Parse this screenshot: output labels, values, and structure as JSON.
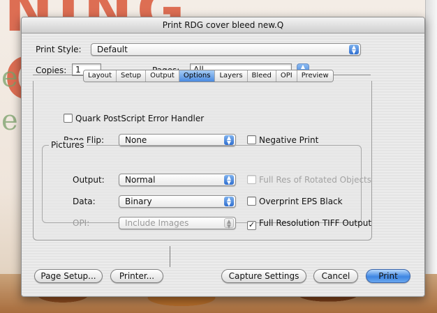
{
  "window": {
    "title": "Print RDG cover bleed new.Q"
  },
  "background": {
    "title_fragment": "NING GUIDE",
    "side_letter_1": "e",
    "side_letter_2": "e"
  },
  "print_style": {
    "label": "Print Style:",
    "value": "Default"
  },
  "copies": {
    "label": "Copies:",
    "value": "1"
  },
  "pages": {
    "label": "Pages:",
    "value": "All"
  },
  "tabs": [
    {
      "label": "Layout"
    },
    {
      "label": "Setup"
    },
    {
      "label": "Output"
    },
    {
      "label": "Options",
      "active": true
    },
    {
      "label": "Layers"
    },
    {
      "label": "Bleed"
    },
    {
      "label": "OPI"
    },
    {
      "label": "Preview"
    }
  ],
  "options": {
    "error_handler": {
      "label": "Quark PostScript Error Handler",
      "checked": false
    },
    "page_flip": {
      "label": "Page Flip:",
      "value": "None"
    },
    "negative_print": {
      "label": "Negative Print",
      "checked": false
    },
    "pictures": {
      "title": "Pictures",
      "output": {
        "label": "Output:",
        "value": "Normal"
      },
      "data": {
        "label": "Data:",
        "value": "Binary"
      },
      "opi": {
        "label": "OPI:",
        "value": "Include Images"
      },
      "full_res_rotated": {
        "label": "Full Res of Rotated Objects",
        "checked": false
      },
      "overprint_eps": {
        "label": "Overprint EPS Black",
        "checked": false
      },
      "full_res_tiff": {
        "label": "Full Resolution TIFF Output",
        "checked": true
      }
    }
  },
  "buttons": {
    "page_setup": "Page Setup...",
    "printer": "Printer...",
    "capture_settings": "Capture Settings",
    "cancel": "Cancel",
    "print": "Print"
  },
  "colors": {
    "accent": "#3e86e3",
    "background_title": "#d9583a"
  }
}
